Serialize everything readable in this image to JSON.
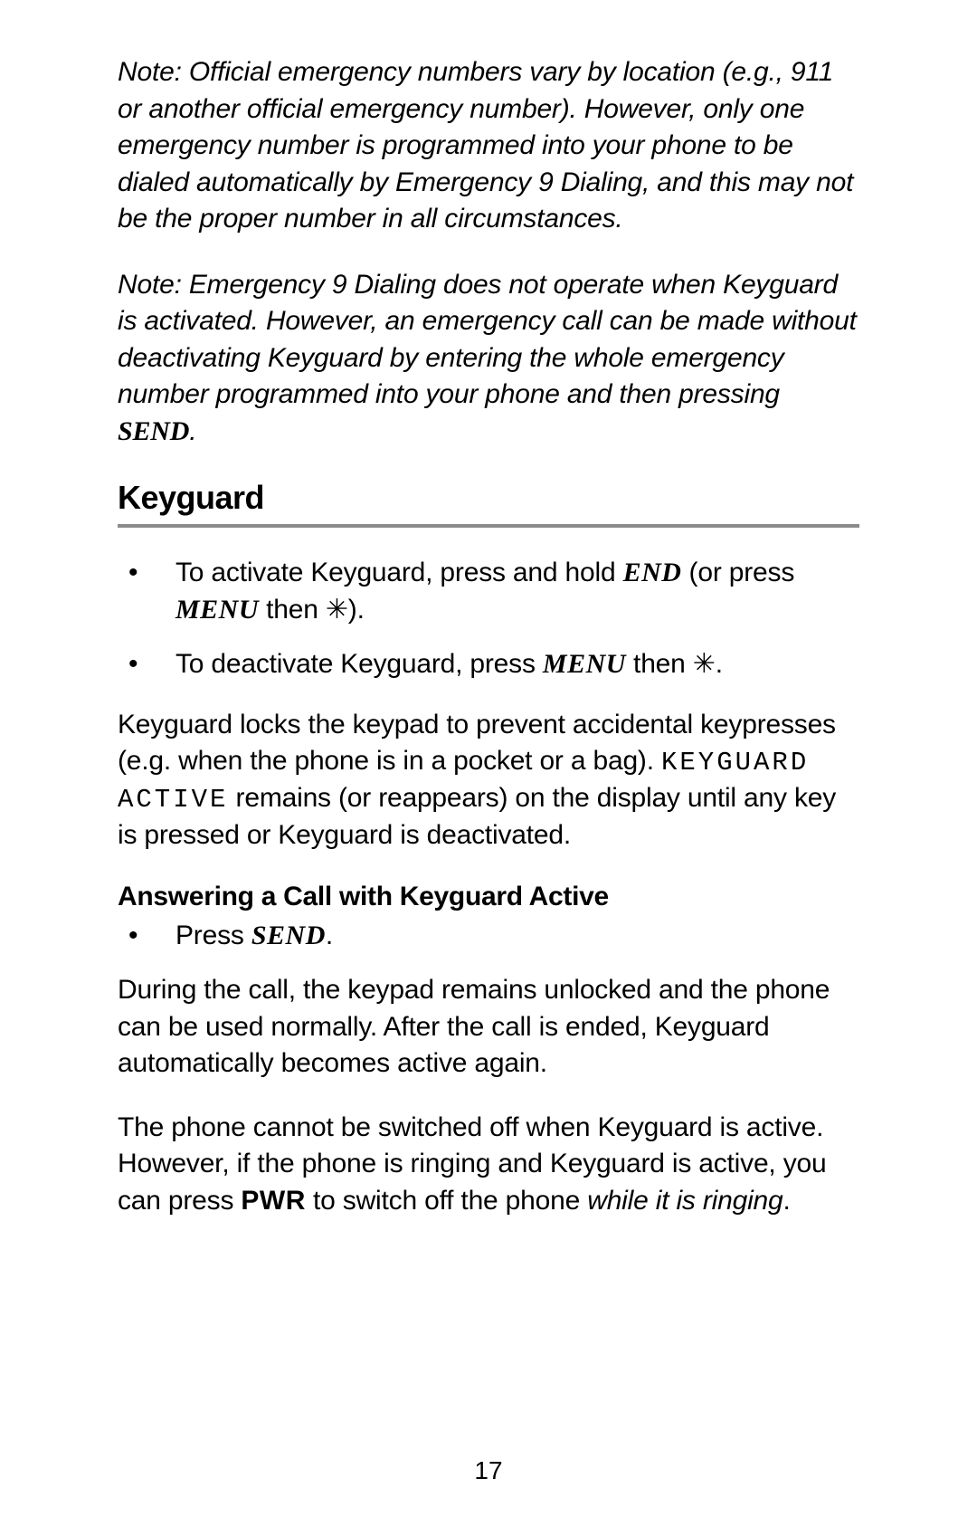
{
  "note1": {
    "text": "Note: Official emergency numbers vary by location (e.g., 911 or another official emergency number). However, only one emergency number is programmed into your phone to be dialed automatically by Emergency 9 Dialing, and this may not be the proper number in all circumstances."
  },
  "note2": {
    "before_send": "Note: Emergency 9 Dialing does not operate when Keyguard is activated. However, an emergency call can be made without deactivating Keyguard by entering the whole emergency number programmed into your phone and then pressing ",
    "send": "SEND",
    "after_send": "."
  },
  "section": {
    "heading": "Keyguard",
    "bullets": {
      "item1": {
        "pre": "To activate Keyguard, press and hold ",
        "end": "END",
        "mid": " (or press ",
        "menu": "MENU",
        "post": " then ✳)."
      },
      "item2": {
        "pre": "To deactivate Keyguard, press ",
        "menu": "MENU",
        "post": " then ✳."
      }
    },
    "para": {
      "pre": "Keyguard locks the keypad to prevent accidental keypresses (e.g. when the phone is in a pocket or a bag). ",
      "display": "KEYGUARD ACTIVE",
      "post": " remains (or reappears) on the display until any key is pressed or Keyguard is deactivated."
    },
    "sub": {
      "heading": "Answering a Call with Keyguard Active",
      "bullet": {
        "pre": "Press ",
        "send": "SEND",
        "post": "."
      },
      "para1": "During the call, the keypad remains unlocked and the phone can be used normally. After the call is ended, Keyguard automatically becomes active again.",
      "para2": {
        "pre": "The phone cannot be switched off when Keyguard is active. However, if the phone is ringing and Keyguard is active, you can press ",
        "pwr": "PWR",
        "mid": " to switch off the phone ",
        "ital": "while it is ringing",
        "post": "."
      }
    }
  },
  "pageNumber": "17"
}
